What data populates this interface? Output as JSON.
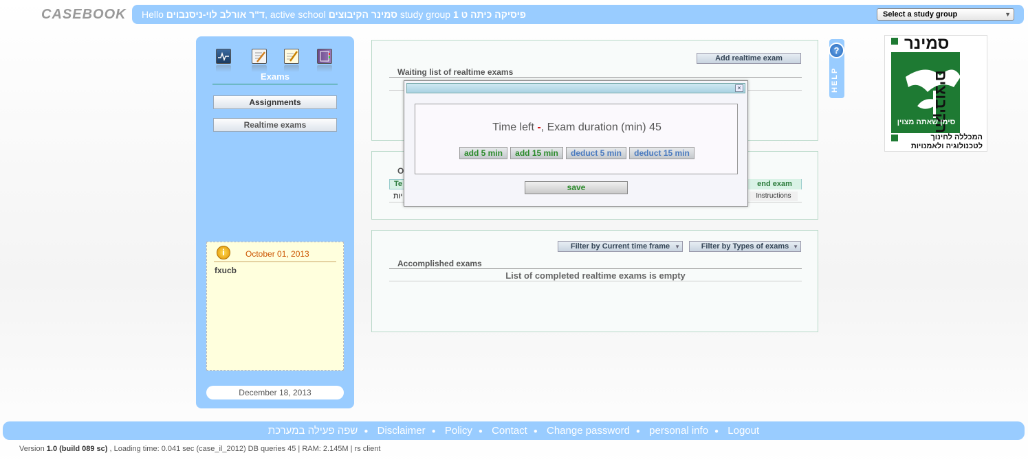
{
  "app": {
    "logo_text": "CASEBOOK"
  },
  "header": {
    "hello": "Hello",
    "user_name": "ד\"ר אורלב לוי-ניסנבוים",
    "active_school_label": ", active school",
    "school_name": "סמינר הקיבוצים",
    "study_group_label": "study group",
    "study_group_name": "פיסיקה כיתה ט 1",
    "select_label": "Select a study group"
  },
  "sidebar": {
    "icons": [
      "monitor-icon",
      "edit-icon",
      "notepad-icon",
      "book-icon"
    ],
    "section_label": "Exams",
    "buttons": [
      "Assignments",
      "Realtime exams"
    ],
    "note": {
      "date": "October 01, 2013",
      "text": "fxucb"
    },
    "current_date": "December 18, 2013"
  },
  "panel_waiting": {
    "add_button": "Add realtime exam",
    "title": "Waiting list of realtime exams"
  },
  "panel_ongoing": {
    "title_partial": "O",
    "header_partial": "Te",
    "end_exam": "end exam",
    "row_partial": "יות",
    "instructions": "Instructions"
  },
  "panel_accomplished": {
    "filter_time": "Filter by Current time frame",
    "filter_types": "Filter by Types of exams",
    "title": "Accomplished exams",
    "empty": "List of completed realtime exams is empty"
  },
  "help": {
    "label": "HELP",
    "icon": "?"
  },
  "school_logo": {
    "line1": "סמינר",
    "line2": "הקיבוצים",
    "tagline": "סימן שאתה מצוין",
    "sub1": "המכללה לחינוך",
    "sub2": "לטכנולוגיה ולאמנויות"
  },
  "modal": {
    "time_left_label": "Time left",
    "time_left_value": "-",
    "duration_label": ", Exam duration (min)",
    "duration_value": "45",
    "buttons": [
      "add 5 min",
      "add 15 min",
      "deduct 5 min",
      "deduct 15 min"
    ],
    "save": "save"
  },
  "footer": {
    "links": [
      "שפה פעילה במערכת",
      "Disclaimer",
      "Policy",
      "Contact",
      "Change password",
      "personal info",
      "Logout"
    ],
    "version_prefix": "Version",
    "version": "1.0 (build 089 sc)",
    "stats": ", Loading time: 0.041 sec  (case_il_2012) DB queries 45 | RAM: 2.145M | rs client"
  },
  "colors": {
    "accent": "#99ccff",
    "panel_border": "#b8d8c8",
    "note_bg": "#ffffdd",
    "logo_green": "#1e7a33"
  }
}
